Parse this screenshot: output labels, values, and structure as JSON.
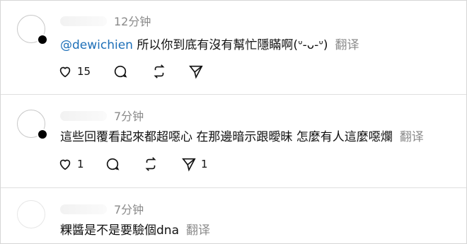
{
  "posts": [
    {
      "time": "12分钟",
      "mention": "@dewichien",
      "body": " 所以你到底有沒有幫忙隱瞞啊(ᐡ-ᴗ-ᐡ)",
      "translate": "翻译",
      "likes": "15",
      "reposts": "",
      "shares": ""
    },
    {
      "time": "7分钟",
      "mention": "",
      "body": "這些回覆看起來都超噁心 在那邊暗示跟曖昧 怎麼有人這麼噁爛",
      "translate": "翻译",
      "likes": "1",
      "reposts": "",
      "shares": "1"
    },
    {
      "time": "7分钟",
      "mention": "",
      "body": "粿醬是不是要驗個dna",
      "translate": "翻译",
      "likes": "",
      "reposts": "",
      "shares": ""
    }
  ],
  "icons": {
    "like": "heart-icon",
    "comment": "comment-icon",
    "repost": "repost-icon",
    "share": "send-icon"
  }
}
